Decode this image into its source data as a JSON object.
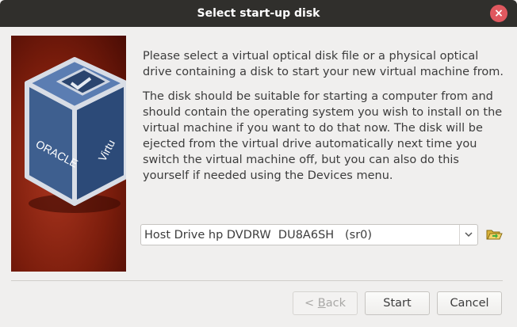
{
  "window": {
    "title": "Select start-up disk",
    "close_glyph": "×"
  },
  "logo": {
    "brand_text_left": "ORACLE",
    "brand_text_right": "Virtu",
    "icon": "virtualbox-logo-icon"
  },
  "body": {
    "paragraph1": "Please select a virtual optical disk file or a physical optical drive containing a disk to start your new virtual machine from.",
    "paragraph2": "The disk should be suitable for starting a computer from and should contain the operating system you wish to install on the virtual machine if you want to do that now. The disk will be ejected from the virtual drive automatically next time you switch the virtual machine off, but you can also do this yourself if needed using the Devices menu."
  },
  "disk_select": {
    "selected": "Host Drive hp DVDRW  DU8A6SH   (sr0)",
    "arrow_icon": "chevron-down-icon",
    "browse_icon": "folder-open-icon"
  },
  "buttons": {
    "back_prefix": "< ",
    "back_mnemonic": "B",
    "back_rest": "ack",
    "start": "Start",
    "cancel": "Cancel"
  },
  "colors": {
    "titlebar": "#302f2c",
    "close": "#e0585f",
    "logo_background": "#7b1d0c"
  }
}
